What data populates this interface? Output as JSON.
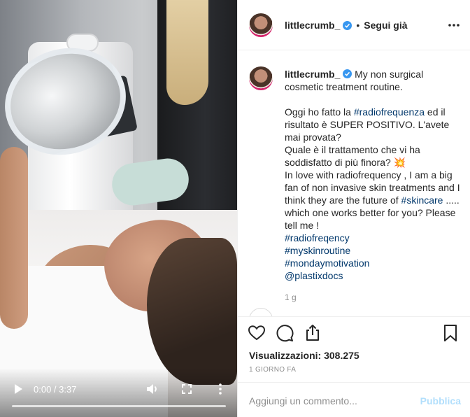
{
  "video": {
    "time": "0:00 / 3:37",
    "progress": 0.0
  },
  "header": {
    "username": "littlecrumb_",
    "separator": "•",
    "follow_label": "Segui già"
  },
  "caption": {
    "username": "littlecrumb_",
    "title": "My non surgical cosmetic treatment routine.",
    "line1_a": "Oggi ho fatto la ",
    "line1_tag": "#radiofrequenza",
    "line1_b": " ed il risultato è SUPER POSITIVO. L'avete mai provata?",
    "line2": "Quale è il trattamento che vi ha soddisfatto di più finora? 💥",
    "line3_a": "In love with radiofrequency , I am a big fan of non invasive skin treatments and I think they are the future of ",
    "line3_tag": "#skincare",
    "line3_b": " ..... which one works better for you? Please tell me !",
    "tags": [
      "#radiofreqency",
      "#myskinroutine",
      "#mondaymotivation",
      "@plastixdocs"
    ],
    "ago": "1 g"
  },
  "stats": {
    "views_label": "Visualizzazioni:",
    "views_value": "308.275",
    "date": "1 GIORNO FA"
  },
  "comment_box": {
    "placeholder": "Aggiungi un commento...",
    "publish_label": "Pubblica"
  },
  "colors": {
    "link": "#00376b",
    "verified": "#3897f0",
    "publish_disabled": "#b2dffc"
  }
}
